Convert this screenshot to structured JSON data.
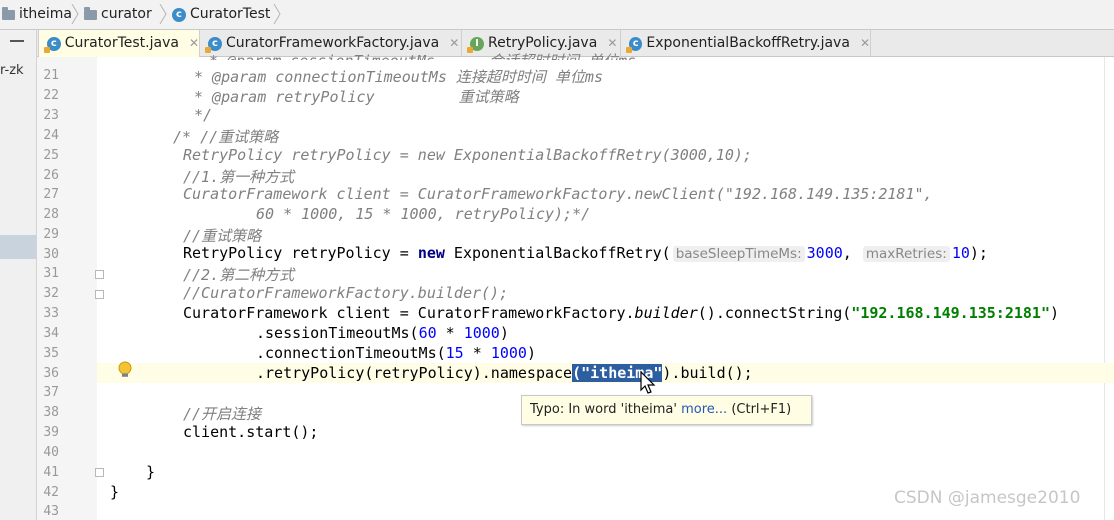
{
  "breadcrumb": {
    "items": [
      "itheima",
      "curator",
      "CuratorTest"
    ]
  },
  "tabs": [
    {
      "label": "CuratorTest.java",
      "active": true,
      "icon": "class-icon"
    },
    {
      "label": "CuratorFrameworkFactory.java",
      "active": false,
      "icon": "class-icon"
    },
    {
      "label": "RetryPolicy.java",
      "active": false,
      "icon": "interface-icon"
    },
    {
      "label": "ExponentialBackoffRetry.java",
      "active": false,
      "icon": "class-icon"
    }
  ],
  "left_panel": {
    "label": "r-zk"
  },
  "editor": {
    "line_numbers": [
      "21",
      "22",
      "23",
      "24",
      "25",
      "26",
      "27",
      "28",
      "29",
      "30",
      "31",
      "32",
      "33",
      "34",
      "35",
      "36",
      "37",
      "38",
      "39",
      "40",
      "41",
      "42",
      "43"
    ],
    "lines": {
      "l21_tag": "* @param connectionTimeoutMs",
      "l21_text": " 连接超时时间 单位ms",
      "l22_tag": "* @param retryPolicy",
      "l22_text": "重试策略",
      "l23": "*/",
      "l24": "/* //重试策略",
      "l25": "RetryPolicy retryPolicy = new ExponentialBackoffRetry(3000,10);",
      "l26": "//1.第一种方式",
      "l27": "CuratorFramework client = CuratorFrameworkFactory.newClient(\"192.168.149.135:2181\",",
      "l28": "60 * 1000, 15 * 1000, retryPolicy);*/",
      "l29": "//重试策略",
      "l30_a": "RetryPolicy retryPolicy = ",
      "l30_kw": "new",
      "l30_b": " ExponentialBackoffRetry(",
      "l30_p1": "baseSleepTimeMs:",
      "l30_v1": "3000",
      "l30_c": ", ",
      "l30_p2": "maxRetries:",
      "l30_v2": "10",
      "l30_d": ");",
      "l31": "//2.第二种方式",
      "l32": "//CuratorFrameworkFactory.builder();",
      "l33_a": "CuratorFramework client = CuratorFrameworkFactory.",
      "l33_b": "builder",
      "l33_c": "().connectString(",
      "l33_str": "\"192.168.149.135:2181\"",
      "l33_d": ")",
      "l34_a": ".sessionTimeoutMs(",
      "l34_n1": "60",
      "l34_b": " * ",
      "l34_n2": "1000",
      "l34_c": ")",
      "l35_a": ".connectionTimeoutMs(",
      "l35_n1": "15",
      "l35_b": " * ",
      "l35_n2": "1000",
      "l35_c": ")",
      "l36_a": ".retryPolicy(retryPolicy).namespace",
      "l36_sel": "(\"itheima\"",
      "l36_b": ").build();",
      "l38": "//开启连接",
      "l39": "client.start();",
      "l41": "}",
      "l42": "}"
    }
  },
  "tooltip": {
    "prefix": "Typo: In word 'itheima'",
    "link": "more...",
    "shortcut": "(Ctrl+F1)"
  },
  "watermark": "CSDN @jamesge2010"
}
